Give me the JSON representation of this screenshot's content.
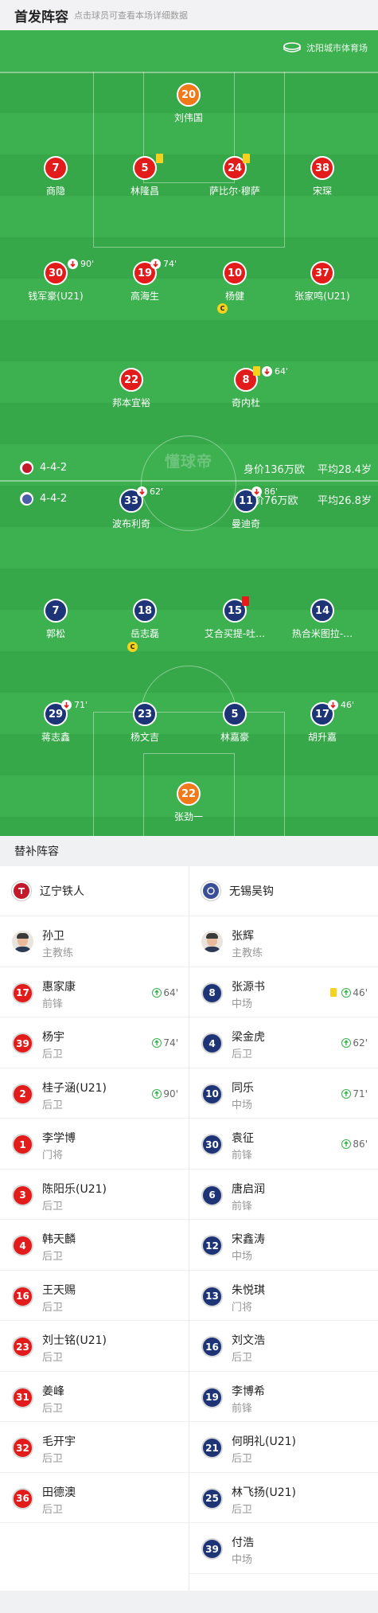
{
  "header": {
    "title": "首发阵容",
    "subtitle": "点击球员可查看本场详细数据"
  },
  "venue": {
    "name": "沈阳城市体育场",
    "icon": "stadium-icon"
  },
  "watermark": "懂球帝",
  "home_info": {
    "formation": "4-4-2",
    "value": "身价136万欧",
    "avg_age": "平均28.4岁"
  },
  "away_info": {
    "formation": "4-4-2",
    "value": "身价76万欧",
    "avg_age": "平均26.8岁"
  },
  "home_starters": [
    {
      "num": "20",
      "name": "刘伟国"
    },
    {
      "num": "7",
      "name": "商隐"
    },
    {
      "num": "5",
      "name": "林隆昌"
    },
    {
      "num": "24",
      "name": "萨比尔·穆萨"
    },
    {
      "num": "38",
      "name": "宋琛"
    },
    {
      "num": "30",
      "name": "钱军豪(U21)",
      "sub_minute": "90'"
    },
    {
      "num": "19",
      "name": "高海生",
      "sub_minute": "74'"
    },
    {
      "num": "10",
      "name": "杨健",
      "captain": "C"
    },
    {
      "num": "37",
      "name": "张家鸣(U21)"
    },
    {
      "num": "22",
      "name": "邦本宜裕"
    },
    {
      "num": "8",
      "name": "奇内杜",
      "sub_minute": "64'"
    }
  ],
  "away_starters": [
    {
      "num": "33",
      "name": "波布利奇",
      "sub_minute": "62'"
    },
    {
      "num": "11",
      "name": "曼迪奇",
      "sub_minute": "86'"
    },
    {
      "num": "7",
      "name": "郭松"
    },
    {
      "num": "18",
      "name": "岳志磊",
      "captain": "C"
    },
    {
      "num": "15",
      "name": "艾合买提-吐…"
    },
    {
      "num": "14",
      "name": "热合米图拉-…"
    },
    {
      "num": "29",
      "name": "蒋志鑫",
      "sub_minute": "71'"
    },
    {
      "num": "23",
      "name": "杨文吉"
    },
    {
      "num": "5",
      "name": "林嘉豪"
    },
    {
      "num": "17",
      "name": "胡升嘉",
      "sub_minute": "46'"
    },
    {
      "num": "22",
      "name": "张劲一"
    }
  ],
  "subs_section_title": "替补阵容",
  "home_team": {
    "name": "辽宁铁人",
    "color": "#e21b1b",
    "coach": {
      "name": "孙卫",
      "role": "主教练"
    },
    "subs": [
      {
        "num": "17",
        "name": "惠家康",
        "pos": "前锋",
        "minute": "64'"
      },
      {
        "num": "39",
        "name": "杨宇",
        "pos": "后卫",
        "minute": "74'"
      },
      {
        "num": "2",
        "name": "桂子涵(U21)",
        "pos": "后卫",
        "minute": "90'"
      },
      {
        "num": "1",
        "name": "李学博",
        "pos": "门将"
      },
      {
        "num": "3",
        "name": "陈阳乐(U21)",
        "pos": "后卫"
      },
      {
        "num": "4",
        "name": "韩天麟",
        "pos": "后卫"
      },
      {
        "num": "16",
        "name": "王天赐",
        "pos": "后卫"
      },
      {
        "num": "23",
        "name": "刘士铭(U21)",
        "pos": "后卫"
      },
      {
        "num": "31",
        "name": "姜峰",
        "pos": "后卫"
      },
      {
        "num": "32",
        "name": "毛开宇",
        "pos": "后卫"
      },
      {
        "num": "36",
        "name": "田德澳",
        "pos": "后卫"
      }
    ]
  },
  "away_team": {
    "name": "无锡吴钩",
    "color": "#1d3577",
    "coach": {
      "name": "张辉",
      "role": "主教练"
    },
    "subs": [
      {
        "num": "8",
        "name": "张源书",
        "pos": "中场",
        "minute": "46'",
        "yellow": true
      },
      {
        "num": "4",
        "name": "梁金虎",
        "pos": "后卫",
        "minute": "62'"
      },
      {
        "num": "10",
        "name": "同乐",
        "pos": "中场",
        "minute": "71'"
      },
      {
        "num": "30",
        "name": "袁征",
        "pos": "前锋",
        "minute": "86'"
      },
      {
        "num": "6",
        "name": "唐启润",
        "pos": "前锋"
      },
      {
        "num": "12",
        "name": "宋鑫涛",
        "pos": "中场"
      },
      {
        "num": "13",
        "name": "朱悦琪",
        "pos": "门将"
      },
      {
        "num": "16",
        "name": "刘文浩",
        "pos": "后卫"
      },
      {
        "num": "19",
        "name": "李博希",
        "pos": "前锋"
      },
      {
        "num": "21",
        "name": "何明礼(U21)",
        "pos": "后卫"
      },
      {
        "num": "25",
        "name": "林飞扬(U21)",
        "pos": "后卫"
      },
      {
        "num": "39",
        "name": "付浩",
        "pos": "中场"
      }
    ]
  }
}
